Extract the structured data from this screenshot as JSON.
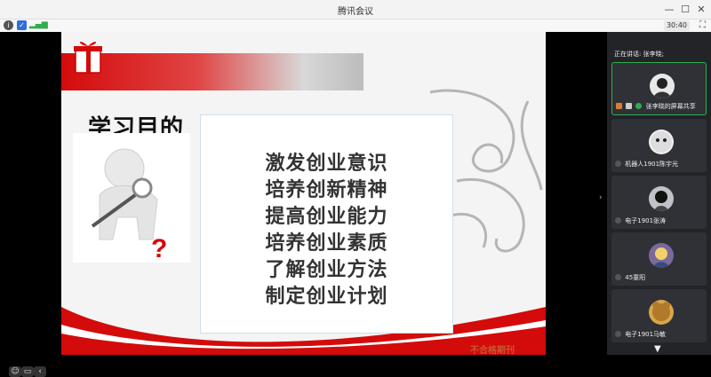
{
  "window": {
    "title": "腾讯会议"
  },
  "infobar": {
    "timer": "30:40"
  },
  "slide": {
    "heading": "学习目的",
    "items": [
      "激发创业意识",
      "培养创新精神",
      "提高创业能力",
      "培养创业素质",
      "了解创业方法",
      "制定创业计划"
    ],
    "bottom_text": "不合格期刊"
  },
  "panel": {
    "speaking": "正在讲话: 张李晓;",
    "participants": [
      {
        "name": "张李晓的屏幕共享",
        "avatar_color": "#e8e8e8"
      },
      {
        "name": "机器人1901陈宇光",
        "avatar_color": "#f0f0f0"
      },
      {
        "name": "电子1901张涛",
        "avatar_color": "#bfc3c8"
      },
      {
        "name": "45童阳",
        "avatar_color": "#7a6a9a"
      },
      {
        "name": "电子1901马敏",
        "avatar_color": "#d9a64a"
      }
    ]
  },
  "colors": {
    "accent_red": "#d40b0b",
    "active_border": "#2fae4f",
    "panel_bg": "#222428"
  }
}
